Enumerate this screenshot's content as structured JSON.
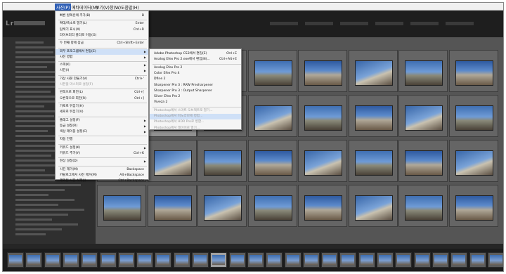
{
  "menubar": {
    "items": [
      {
        "label": "사진(P)",
        "active": true
      },
      {
        "label": "메타데이터(M)"
      },
      {
        "label": "보기(V)"
      },
      {
        "label": "창(W)"
      },
      {
        "label": "도움말(H)"
      }
    ]
  },
  "photo_menu": {
    "items": [
      {
        "label": "빠른 컬렉션에 추가(B)",
        "shortcut": "B"
      },
      {
        "label": "확대/축소로 열기(L)",
        "shortcut": "Enter"
      },
      {
        "label": "탐색기 표시(X)",
        "shortcut": "Ctrl+R"
      },
      {
        "label": "라이브러리 폴더로 이동(G)",
        "shortcut": ""
      },
      {
        "label": "두 번째 창에 잠금",
        "shortcut": "Ctrl+Shift+Enter"
      },
      {
        "label": "외부 프로그램에서 편집(E)",
        "shortcut": "",
        "submenu": true,
        "highlighted": true
      },
      {
        "label": "사진 병합",
        "shortcut": "",
        "submenu": true
      },
      {
        "label": "스택(K)",
        "shortcut": "",
        "submenu": true
      },
      {
        "label": "사진(I)",
        "shortcut": "",
        "submenu": true
      },
      {
        "label": "가상 사본 만들기(V)",
        "shortcut": "Ctrl+'"
      },
      {
        "label": "사본을 마스터로 설정(F)",
        "shortcut": "",
        "disabled": true
      },
      {
        "label": "왼쪽으로 회전(L)",
        "shortcut": "Ctrl+["
      },
      {
        "label": "오른쪽으로 회전(R)",
        "shortcut": "Ctrl+]"
      },
      {
        "label": "가로로 뒤집기(H)",
        "shortcut": ""
      },
      {
        "label": "세로로 뒤집기(V)",
        "shortcut": ""
      },
      {
        "label": "플래그 설정(F)",
        "shortcut": "",
        "submenu": true
      },
      {
        "label": "등급 설정(R)",
        "shortcut": "",
        "submenu": true
      },
      {
        "label": "색상 레이블 설정(C)",
        "shortcut": "",
        "submenu": true
      },
      {
        "label": "자동 진행",
        "shortcut": ""
      },
      {
        "label": "키워드 설정(K)",
        "shortcut": "",
        "submenu": true
      },
      {
        "label": "키워드 추가(Y)",
        "shortcut": "Ctrl+K"
      },
      {
        "label": "현상 설정(D)",
        "shortcut": "",
        "submenu": true
      },
      {
        "label": "사진 제거(M)",
        "shortcut": "Backspace"
      },
      {
        "label": "카탈로그에서 사진 제거(M)",
        "shortcut": "Alt+Backspace"
      },
      {
        "label": "제외된 사진 삭제(J)",
        "shortcut": "Ctrl+Backspace"
      }
    ]
  },
  "edit_submenu": {
    "items": [
      {
        "label": "Adobe Photoshop CS3에서 편집(E)",
        "shortcut": "Ctrl+E"
      },
      {
        "label": "Analog Efex Pro 2.exe에서 편집(N)...",
        "shortcut": "Ctrl+Alt+E"
      },
      {
        "label": "Analog Efex Pro 2",
        "shortcut": ""
      },
      {
        "label": "Color Efex Pro 4",
        "shortcut": ""
      },
      {
        "label": "Dfine 2",
        "shortcut": ""
      },
      {
        "label": "Sharpener Pro 3 : RAW Presharpener",
        "shortcut": ""
      },
      {
        "label": "Sharpener Pro 3 : Output Sharpener",
        "shortcut": ""
      },
      {
        "label": "Silver Efex Pro 2",
        "shortcut": ""
      },
      {
        "label": "Viveza 2",
        "shortcut": ""
      },
      {
        "label": "Photoshop에서 스마트 오브젝트로 열기...",
        "shortcut": "",
        "disabled": true
      },
      {
        "label": "Photoshop에서 파노라마에 병합...",
        "shortcut": "",
        "disabled": true,
        "highlighted": true
      },
      {
        "label": "Photoshop에서 HDR Pro로 병합...",
        "shortcut": "",
        "disabled": true
      },
      {
        "label": "Photoshop에서 레이어로 열기...",
        "shortcut": "",
        "disabled": true
      }
    ]
  },
  "grid": {
    "cells": [
      {
        "num": "",
        "thumb": false
      },
      {
        "num": "",
        "thumb": true
      },
      {
        "num": "",
        "thumb": true
      },
      {
        "num": "",
        "thumb": true
      },
      {
        "num": "",
        "thumb": true
      },
      {
        "num": "",
        "thumb": true
      },
      {
        "num": "",
        "thumb": true
      },
      {
        "num": "",
        "thumb": true
      },
      {
        "num": "",
        "thumb": false
      },
      {
        "num": "",
        "thumb": true,
        "selected": true
      },
      {
        "num": "",
        "thumb": true
      },
      {
        "num": "",
        "thumb": true
      },
      {
        "num": "",
        "thumb": true
      },
      {
        "num": "",
        "thumb": true
      },
      {
        "num": "",
        "thumb": true
      },
      {
        "num": "",
        "thumb": true
      },
      {
        "num": "",
        "thumb": true
      },
      {
        "num": "",
        "thumb": true
      },
      {
        "num": "",
        "thumb": true
      },
      {
        "num": "",
        "thumb": true
      },
      {
        "num": "",
        "thumb": true
      },
      {
        "num": "",
        "thumb": true
      },
      {
        "num": "",
        "thumb": true
      },
      {
        "num": "",
        "thumb": true
      },
      {
        "num": "",
        "thumb": true
      },
      {
        "num": "",
        "thumb": true
      },
      {
        "num": "",
        "thumb": true
      },
      {
        "num": "",
        "thumb": true
      },
      {
        "num": "",
        "thumb": true
      },
      {
        "num": "",
        "thumb": true
      },
      {
        "num": "",
        "thumb": true
      },
      {
        "num": "",
        "thumb": true
      }
    ]
  },
  "filmstrip": {
    "selected_index": 11
  }
}
